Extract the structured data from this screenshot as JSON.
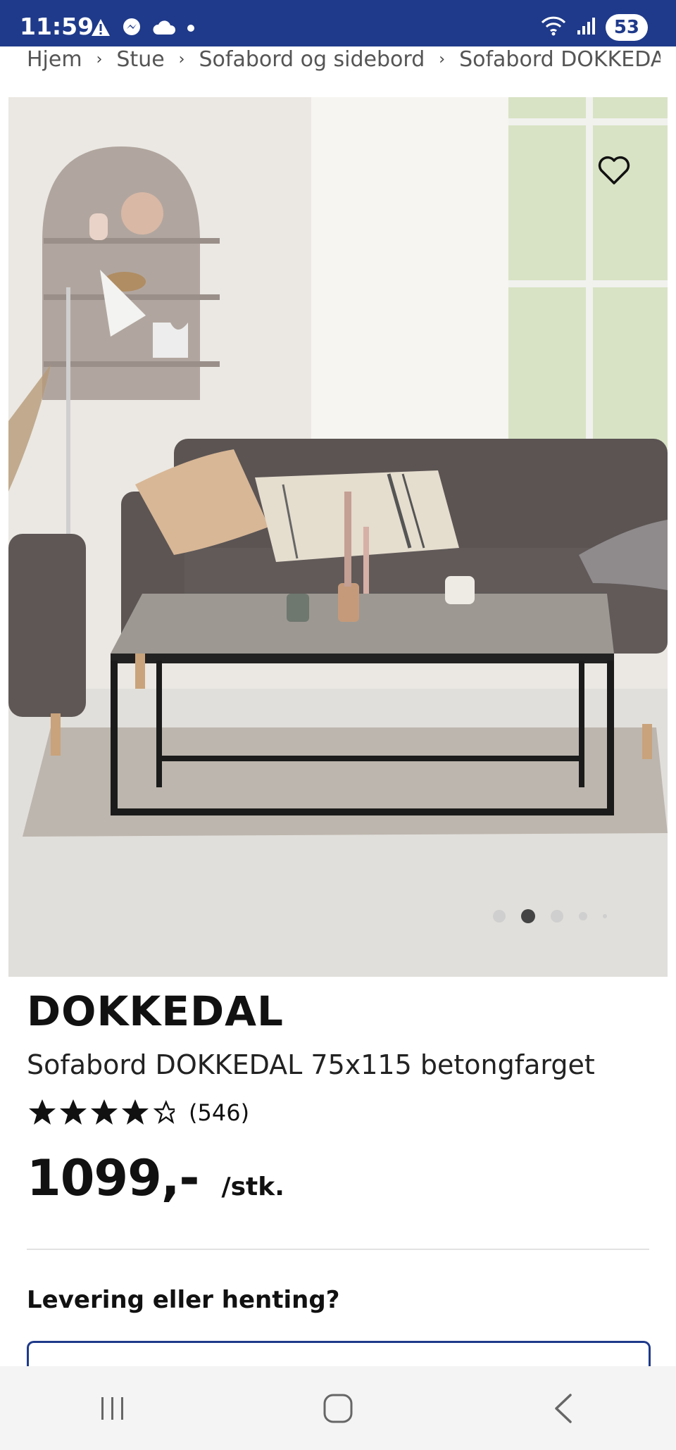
{
  "status_bar": {
    "time": "11:59",
    "battery": "53",
    "icons_left": [
      "warning-icon",
      "messenger-icon",
      "cloud-icon",
      "dot-icon"
    ],
    "icons_right": [
      "wifi-icon",
      "signal-icon"
    ]
  },
  "breadcrumb": {
    "items": [
      "Hjem",
      "Stue",
      "Sofabord og sidebord",
      "Sofabord DOKKEDAL"
    ]
  },
  "gallery": {
    "image_alt": "Sofabord DOKKEDAL",
    "total": 5,
    "active_index": 1,
    "favorite_icon": "heart-outline-icon"
  },
  "product": {
    "brand": "DOKKEDAL",
    "name": "Sofabord DOKKEDAL 75x115 betongfarget",
    "rating": 4,
    "rating_max": 5,
    "review_count": "(546)",
    "price": "1099,-",
    "unit": "/stk."
  },
  "delivery": {
    "heading": "Levering eller henting?"
  },
  "colors": {
    "status_bar": "#1f3a8a",
    "accent": "#1f3a8a"
  },
  "nav": {
    "icons": [
      "recent-apps-icon",
      "home-icon",
      "back-icon"
    ]
  }
}
